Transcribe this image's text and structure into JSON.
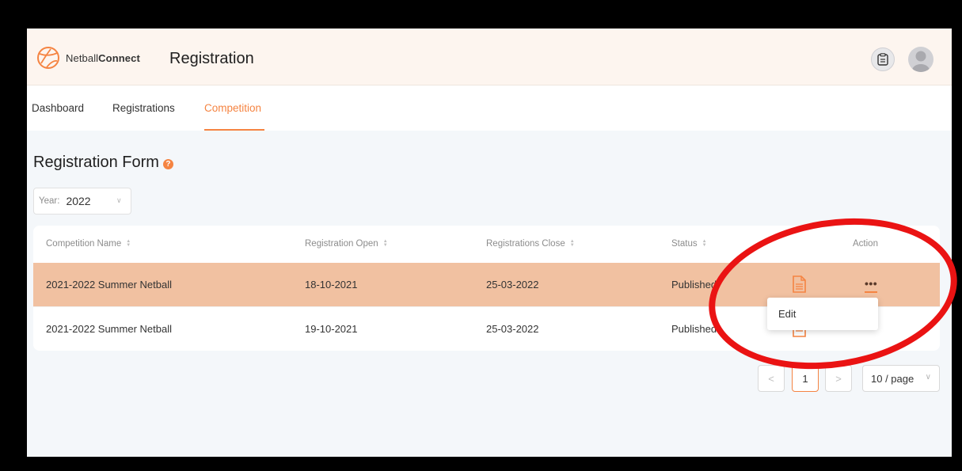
{
  "header": {
    "logo_prefix": "Netball",
    "logo_suffix": "Connect",
    "page_title": "Registration"
  },
  "nav": {
    "tabs": [
      {
        "label": "Dashboard",
        "active": false
      },
      {
        "label": "Registrations",
        "active": false
      },
      {
        "label": "Competition",
        "active": true
      }
    ]
  },
  "main": {
    "title": "Registration Form",
    "help_icon": "?",
    "year_filter": {
      "label": "Year:",
      "value": "2022"
    }
  },
  "table": {
    "columns": [
      "Competition Name",
      "Registration Open",
      "Registrations Close",
      "Status",
      "Action"
    ],
    "rows": [
      {
        "name": "2021-2022 Summer Netball",
        "open": "18-10-2021",
        "close": "25-03-2022",
        "status": "Published",
        "selected": true
      },
      {
        "name": "2021-2022 Summer Netball",
        "open": "19-10-2021",
        "close": "25-03-2022",
        "status": "Published",
        "selected": false
      }
    ],
    "action_menu": "•••"
  },
  "dropdown": {
    "items": [
      "Edit"
    ]
  },
  "pagination": {
    "prev": "<",
    "current": "1",
    "next": ">",
    "page_size": "10 / page"
  },
  "colors": {
    "accent": "#f58442",
    "selected_row": "#f1c1a1",
    "header_bg": "#fdf5ef",
    "annotation": "#ea1313"
  },
  "icons": {
    "logo": "netball-icon",
    "clipboard": "clipboard-icon",
    "avatar": "user-avatar-icon",
    "document": "document-icon"
  }
}
